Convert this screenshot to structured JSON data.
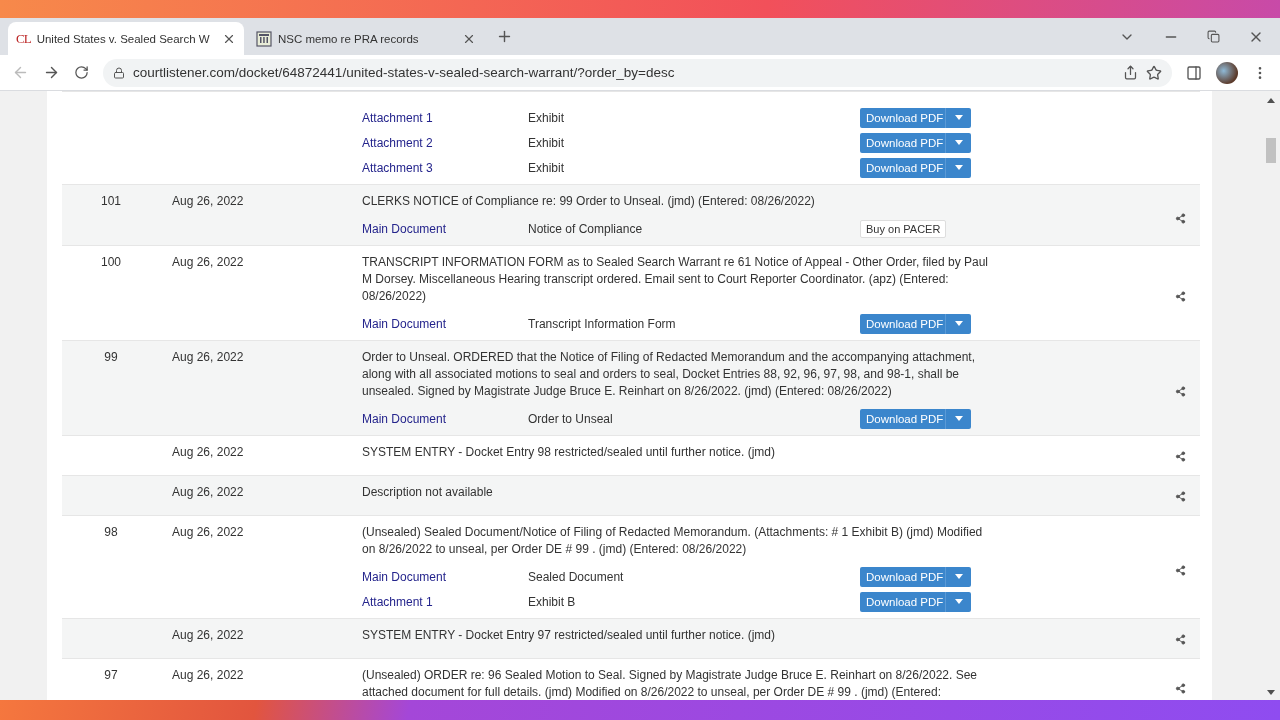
{
  "browser": {
    "tabs": [
      {
        "favicon": "CL",
        "title": "United States v. Sealed Search W",
        "selected": true
      },
      {
        "title": "NSC memo re PRA records",
        "selected": false
      }
    ],
    "url": "courtlistener.com/docket/64872441/united-states-v-sealed-search-warrant/?order_by=desc"
  },
  "docket": {
    "entries": [
      {
        "documents": [
          {
            "label": "Attachment 1",
            "type": "Exhibit",
            "action": {
              "kind": "download",
              "label": "Download PDF"
            }
          },
          {
            "label": "Attachment 2",
            "type": "Exhibit",
            "action": {
              "kind": "download",
              "label": "Download PDF"
            }
          },
          {
            "label": "Attachment 3",
            "type": "Exhibit",
            "action": {
              "kind": "download",
              "label": "Download PDF"
            }
          }
        ]
      },
      {
        "number": "101",
        "date": "Aug 26, 2022",
        "description": "CLERKS NOTICE of Compliance re: 99 Order to Unseal. (jmd) (Entered: 08/26/2022)",
        "documents": [
          {
            "label": "Main Document",
            "type": "Notice of Compliance",
            "action": {
              "kind": "pacer",
              "label": "Buy on PACER"
            }
          }
        ]
      },
      {
        "number": "100",
        "date": "Aug 26, 2022",
        "description": "TRANSCRIPT INFORMATION FORM as to Sealed Search Warrant re 61 Notice of Appeal - Other Order, filed by Paul M Dorsey. Miscellaneous Hearing transcript ordered. Email sent to Court Reporter Coordinator. (apz) (Entered: 08/26/2022)",
        "documents": [
          {
            "label": "Main Document",
            "type": "Transcript Information Form",
            "action": {
              "kind": "download",
              "label": "Download PDF"
            }
          }
        ]
      },
      {
        "number": "99",
        "date": "Aug 26, 2022",
        "description": "Order to Unseal. ORDERED that the Notice of Filing of Redacted Memorandum and the accompanying attachment, along with all associated motions to seal and orders to seal, Docket Entries 88, 92, 96, 97, 98, and 98-1, shall be unsealed. Signed by Magistrate Judge Bruce E. Reinhart on 8/26/2022. (jmd) (Entered: 08/26/2022)",
        "documents": [
          {
            "label": "Main Document",
            "type": "Order to Unseal",
            "action": {
              "kind": "download",
              "label": "Download PDF"
            }
          }
        ]
      },
      {
        "date": "Aug 26, 2022",
        "description": "SYSTEM ENTRY - Docket Entry 98 restricted/sealed until further notice. (jmd)"
      },
      {
        "date": "Aug 26, 2022",
        "description": "Description not available"
      },
      {
        "number": "98",
        "date": "Aug 26, 2022",
        "description": "(Unsealed) Sealed Document/Notice of Filing of Redacted Memorandum. (Attachments: # 1 Exhibit B) (jmd) Modified on 8/26/2022 to unseal, per Order DE # 99 . (jmd) (Entered: 08/26/2022)",
        "documents": [
          {
            "label": "Main Document",
            "type": "Sealed Document",
            "action": {
              "kind": "download",
              "label": "Download PDF"
            }
          },
          {
            "label": "Attachment 1",
            "type": "Exhibit B",
            "action": {
              "kind": "download",
              "label": "Download PDF"
            }
          }
        ]
      },
      {
        "date": "Aug 26, 2022",
        "description": "SYSTEM ENTRY - Docket Entry 97 restricted/sealed until further notice. (jmd)"
      },
      {
        "number": "97",
        "date": "Aug 26, 2022",
        "description": "(Unsealed) ORDER re: 96 Sealed Motion to Seal. Signed by Magistrate Judge Bruce E. Reinhart on 8/26/2022. See attached document for full details. (jmd) Modified on 8/26/2022 to unseal, per Order DE # 99 . (jmd) (Entered:"
      }
    ]
  }
}
